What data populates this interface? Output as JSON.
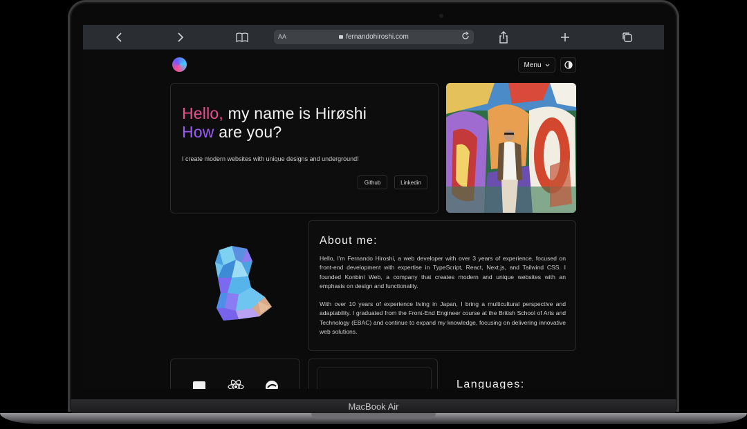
{
  "device": {
    "label": "MacBook Air"
  },
  "browser": {
    "text_size_label": "AA",
    "url": "fernandohiroshi.com",
    "icons": [
      "back-icon",
      "forward-icon",
      "bookmarks-icon",
      "lock-icon",
      "reload-icon",
      "share-icon",
      "new-tab-icon",
      "tabs-icon"
    ]
  },
  "header": {
    "menu_label": "Menu",
    "theme_toggle_icon": "contrast-icon"
  },
  "hero": {
    "hello": "Hello,",
    "line1_rest": " my name is Hirøshi",
    "how": "How",
    "line2_rest": " are you?",
    "tagline": "I create modern websites with unique designs and underground!",
    "github_label": "Github",
    "linkedin_label": "Linkedin"
  },
  "about": {
    "title": "About me:",
    "paragraph1": "Hello, I'm Fernando Hiroshi, a web developer with over 3 years of experience, focused on front-end development with expertise in TypeScript, React, Next.js, and Tailwind CSS. I founded Konbini Web, a company that creates modern and unique websites with an emphasis on design and functionality.",
    "paragraph2": "With over 10 years of experience living in Japan, I bring a multicultural perspective and adaptability. I graduated from the Front-End Engineer course at the British School of Arts and Technology (EBAC) and continue to expand my knowledge, focusing on delivering innovative web solutions."
  },
  "languages": {
    "title": "Languages:"
  },
  "tech_icons": [
    "javascript-icon",
    "react-icon",
    "redux-icon"
  ],
  "colors": {
    "hello_accent": "#ea4e8f",
    "how_accent": "#9b5cf5",
    "page_bg": "#0b0b0b"
  }
}
